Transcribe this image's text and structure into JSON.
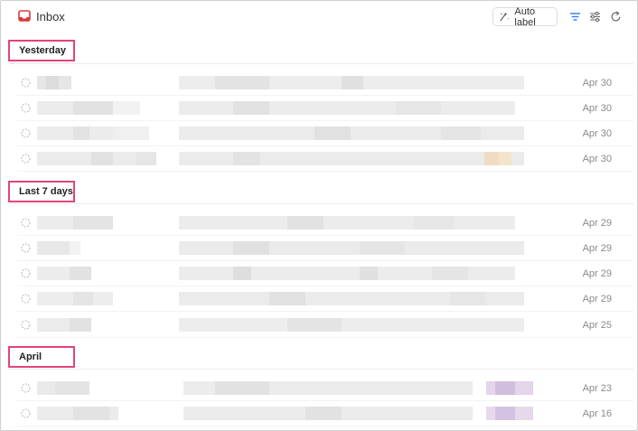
{
  "header": {
    "title": "Inbox",
    "inbox_icon": "inbox-tray-icon",
    "auto_label_button": "Auto label",
    "auto_label_icon": "auto-label-icon",
    "filter_icon": "filter-icon",
    "settings_icon": "sliders-icon",
    "refresh_icon": "refresh-icon",
    "accent_color": "#3b82f6",
    "inbox_icon_color": "#d83b3b"
  },
  "highlight_color": "#e0457b",
  "sections": [
    {
      "label": "Yesterday",
      "rows": [
        {
          "date": "Apr 30"
        },
        {
          "date": "Apr 30"
        },
        {
          "date": "Apr 30"
        },
        {
          "date": "Apr 30"
        }
      ]
    },
    {
      "label": "Last 7 days",
      "rows": [
        {
          "date": "Apr 29"
        },
        {
          "date": "Apr 29"
        },
        {
          "date": "Apr 29"
        },
        {
          "date": "Apr 29"
        },
        {
          "date": "Apr 25"
        }
      ]
    },
    {
      "label": "April",
      "rows": [
        {
          "date": "Apr 23"
        },
        {
          "date": "Apr 16"
        }
      ]
    }
  ]
}
